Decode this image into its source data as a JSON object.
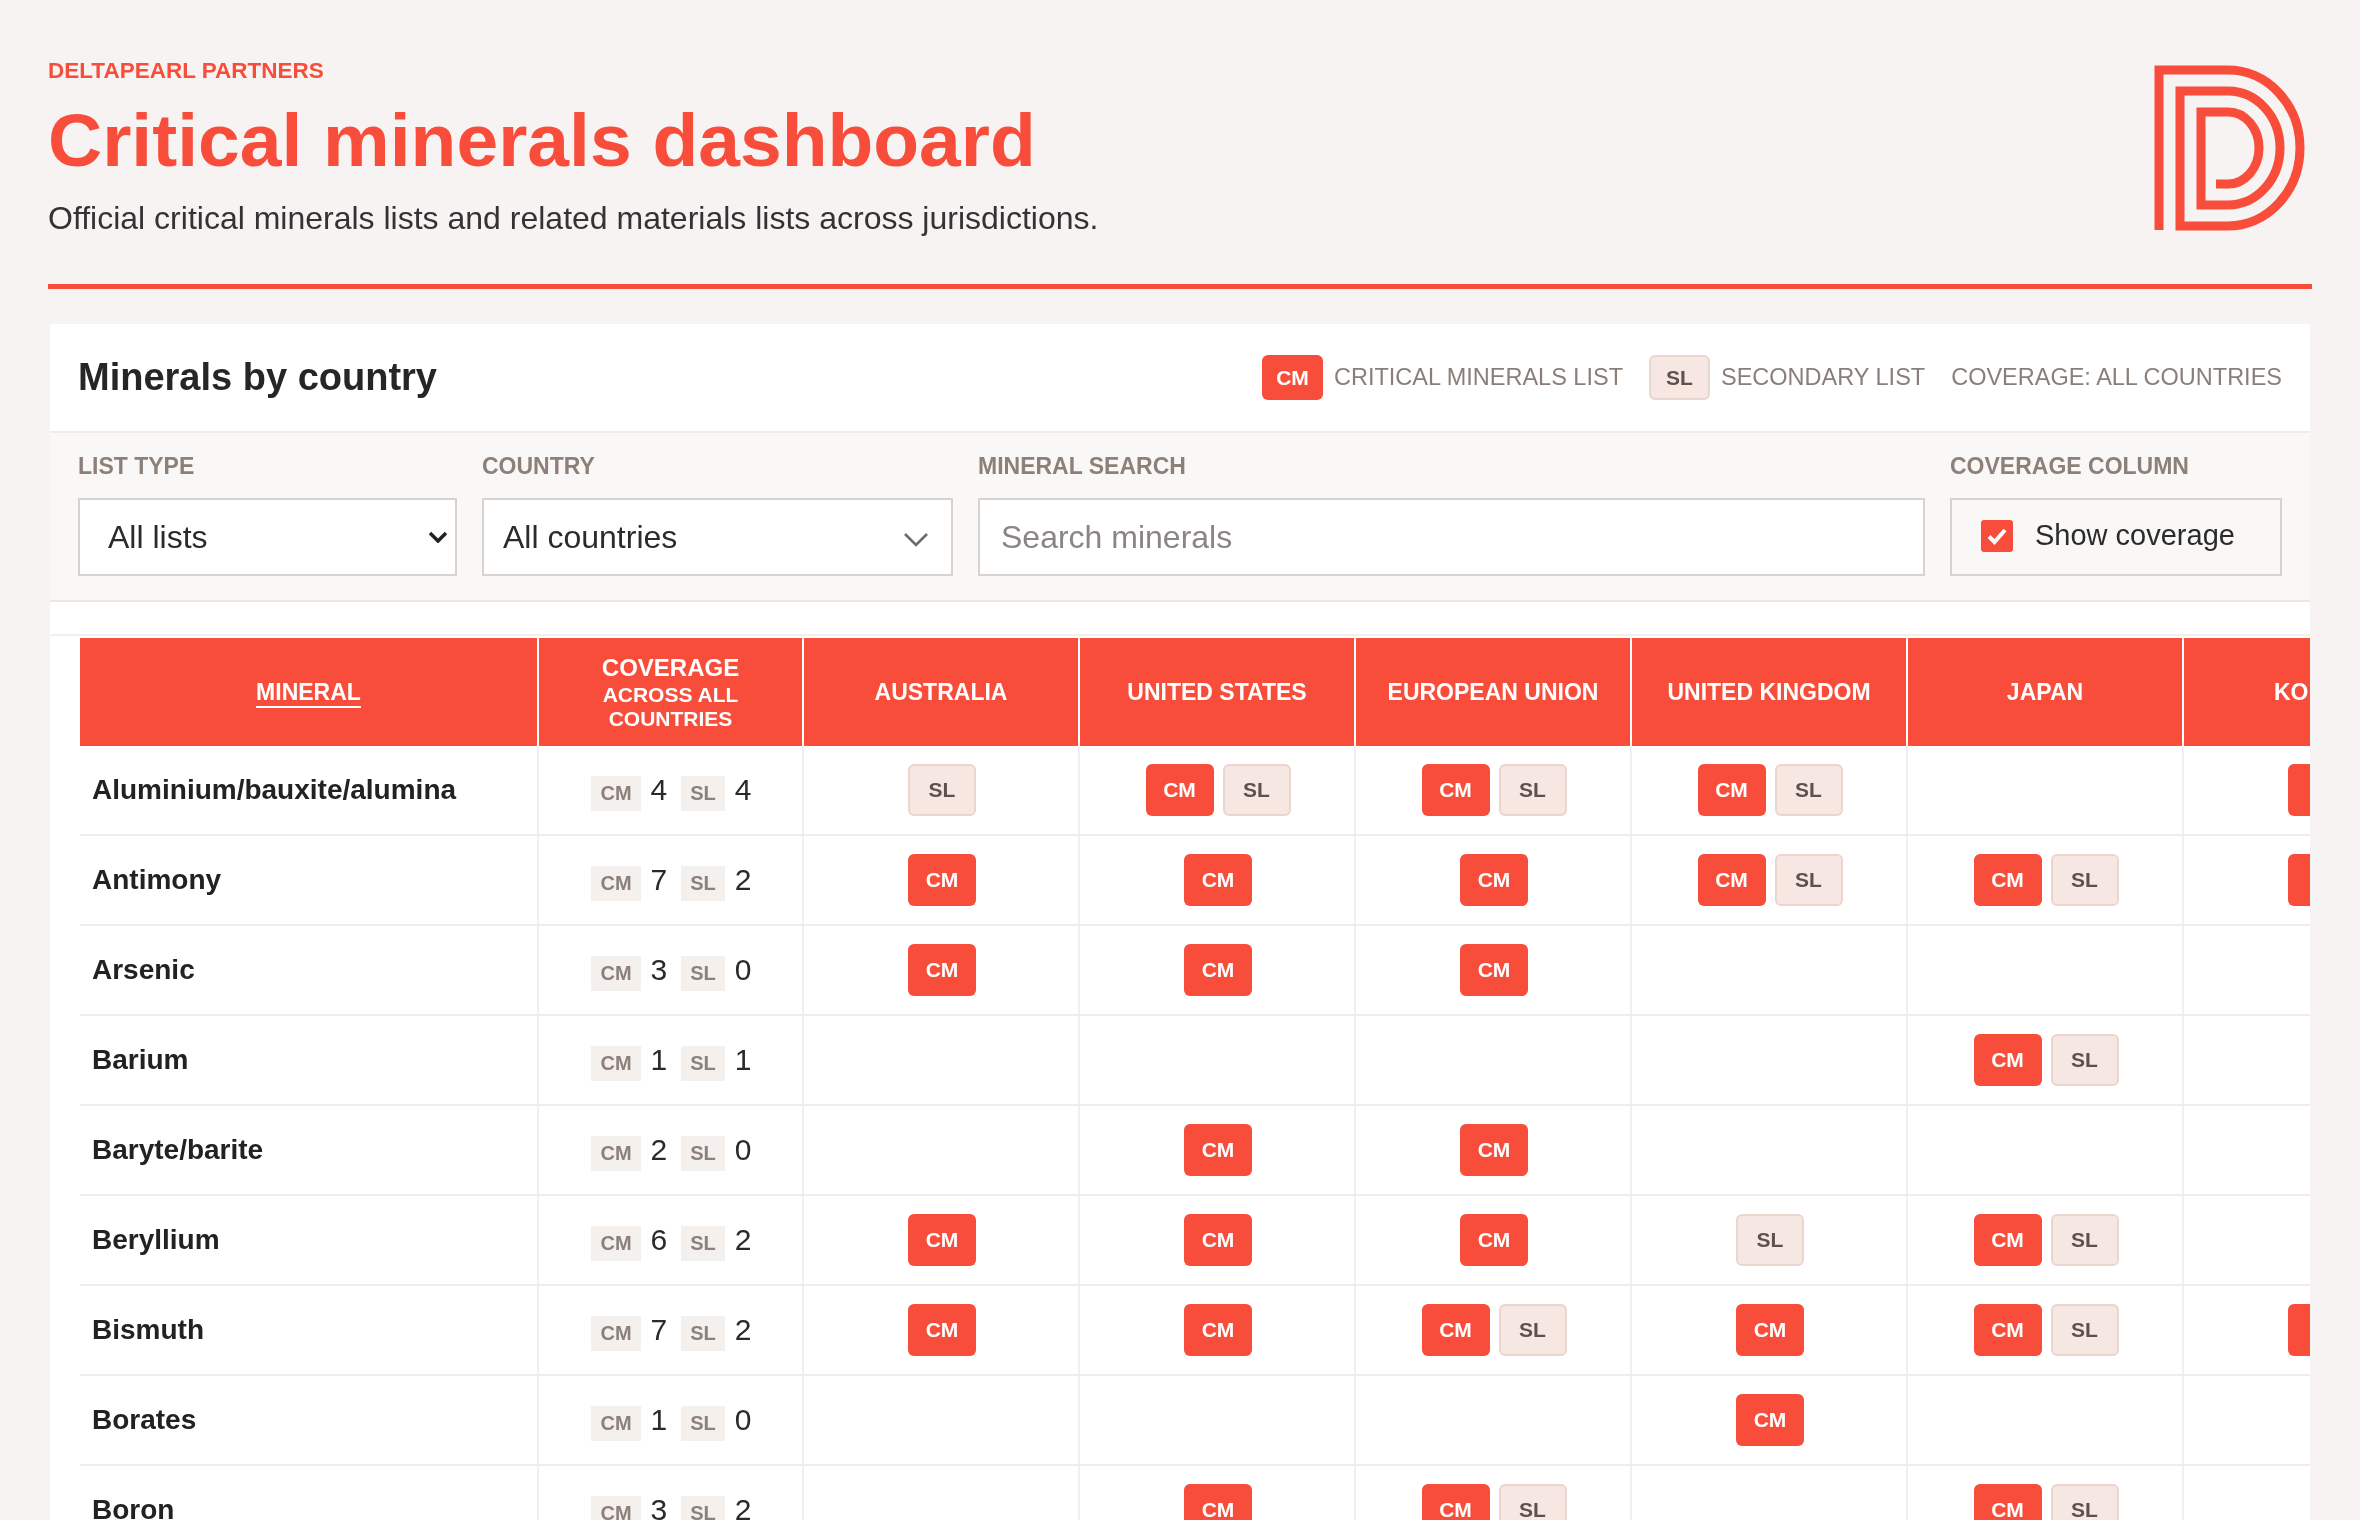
{
  "header": {
    "eyebrow": "DELTAPEARL PARTNERS",
    "title": "Critical minerals dashboard",
    "subtitle": "Official critical minerals lists and related materials lists across jurisdictions."
  },
  "panel": {
    "title": "Minerals by country",
    "legend": [
      {
        "kind": "cm",
        "badge": "CM",
        "label": "CRITICAL MINERALS LIST"
      },
      {
        "kind": "sl",
        "badge": "SL",
        "label": "SECONDARY LIST"
      }
    ],
    "coverage_note": "COVERAGE: ALL COUNTRIES"
  },
  "filters": [
    {
      "kind": "select",
      "label": "LIST TYPE",
      "value": "All lists"
    },
    {
      "kind": "dropdown",
      "label": "COUNTRY",
      "value": "All countries"
    },
    {
      "kind": "search",
      "label": "MINERAL SEARCH",
      "placeholder": "Search minerals"
    },
    {
      "kind": "checkbox",
      "label": "COVERAGE COLUMN",
      "text": "Show coverage",
      "checked": true
    }
  ],
  "table": {
    "columns": [
      {
        "kind": "mineral",
        "label": "MINERAL",
        "sorted": true
      },
      {
        "kind": "coverage",
        "label": "COVERAGE",
        "sublabel": "ACROSS ALL COUNTRIES",
        "sorted": false
      },
      {
        "kind": "country",
        "label": "AUSTRALIA",
        "sorted": false
      },
      {
        "kind": "country",
        "label": "UNITED STATES",
        "sorted": false
      },
      {
        "kind": "country",
        "label": "EUROPEAN UNION",
        "sorted": false
      },
      {
        "kind": "country",
        "label": "UNITED KINGDOM",
        "sorted": false
      },
      {
        "kind": "country",
        "label": "JAPAN",
        "sorted": false
      },
      {
        "kind": "cut",
        "label": "KO",
        "sorted": false
      }
    ],
    "rows": [
      {
        "cells": [
          "Aluminium/bauxite/alumina",
          [
            {
              "tag": "CM",
              "count": "4"
            },
            {
              "tag": "SL",
              "count": "4"
            }
          ],
          [
            {
              "kind": "sl",
              "label": "SL"
            }
          ],
          [
            {
              "kind": "cm",
              "label": "CM"
            },
            {
              "kind": "sl",
              "label": "SL"
            }
          ],
          [
            {
              "kind": "cm",
              "label": "CM"
            },
            {
              "kind": "sl",
              "label": "SL"
            }
          ],
          [
            {
              "kind": "cm",
              "label": "CM"
            },
            {
              "kind": "sl",
              "label": "SL"
            }
          ],
          "",
          [
            {
              "kind": "cm"
            }
          ]
        ]
      },
      {
        "cells": [
          "Antimony",
          [
            {
              "tag": "CM",
              "count": "7"
            },
            {
              "tag": "SL",
              "count": "2"
            }
          ],
          [
            {
              "kind": "cm",
              "label": "CM"
            }
          ],
          [
            {
              "kind": "cm",
              "label": "CM"
            }
          ],
          [
            {
              "kind": "cm",
              "label": "CM"
            }
          ],
          [
            {
              "kind": "cm",
              "label": "CM"
            },
            {
              "kind": "sl",
              "label": "SL"
            }
          ],
          [
            {
              "kind": "cm",
              "label": "CM"
            },
            {
              "kind": "sl",
              "label": "SL"
            }
          ],
          [
            {
              "kind": "cm"
            }
          ]
        ]
      },
      {
        "cells": [
          "Arsenic",
          [
            {
              "tag": "CM",
              "count": "3"
            },
            {
              "tag": "SL",
              "count": "0"
            }
          ],
          [
            {
              "kind": "cm",
              "label": "CM"
            }
          ],
          [
            {
              "kind": "cm",
              "label": "CM"
            }
          ],
          [
            {
              "kind": "cm",
              "label": "CM"
            }
          ],
          "",
          "",
          ""
        ]
      },
      {
        "cells": [
          "Barium",
          [
            {
              "tag": "CM",
              "count": "1"
            },
            {
              "tag": "SL",
              "count": "1"
            }
          ],
          "",
          "",
          "",
          "",
          [
            {
              "kind": "cm",
              "label": "CM"
            },
            {
              "kind": "sl",
              "label": "SL"
            }
          ],
          ""
        ]
      },
      {
        "cells": [
          "Baryte/barite",
          [
            {
              "tag": "CM",
              "count": "2"
            },
            {
              "tag": "SL",
              "count": "0"
            }
          ],
          "",
          [
            {
              "kind": "cm",
              "label": "CM"
            }
          ],
          [
            {
              "kind": "cm",
              "label": "CM"
            }
          ],
          "",
          "",
          ""
        ]
      },
      {
        "cells": [
          "Beryllium",
          [
            {
              "tag": "CM",
              "count": "6"
            },
            {
              "tag": "SL",
              "count": "2"
            }
          ],
          [
            {
              "kind": "cm",
              "label": "CM"
            }
          ],
          [
            {
              "kind": "cm",
              "label": "CM"
            }
          ],
          [
            {
              "kind": "cm",
              "label": "CM"
            }
          ],
          [
            {
              "kind": "sl",
              "label": "SL"
            }
          ],
          [
            {
              "kind": "cm",
              "label": "CM"
            },
            {
              "kind": "sl",
              "label": "SL"
            }
          ],
          ""
        ]
      },
      {
        "cells": [
          "Bismuth",
          [
            {
              "tag": "CM",
              "count": "7"
            },
            {
              "tag": "SL",
              "count": "2"
            }
          ],
          [
            {
              "kind": "cm",
              "label": "CM"
            }
          ],
          [
            {
              "kind": "cm",
              "label": "CM"
            }
          ],
          [
            {
              "kind": "cm",
              "label": "CM"
            },
            {
              "kind": "sl",
              "label": "SL"
            }
          ],
          [
            {
              "kind": "cm",
              "label": "CM"
            }
          ],
          [
            {
              "kind": "cm",
              "label": "CM"
            },
            {
              "kind": "sl",
              "label": "SL"
            }
          ],
          [
            {
              "kind": "cm"
            }
          ]
        ]
      },
      {
        "cells": [
          "Borates",
          [
            {
              "tag": "CM",
              "count": "1"
            },
            {
              "tag": "SL",
              "count": "0"
            }
          ],
          "",
          "",
          "",
          [
            {
              "kind": "cm",
              "label": "CM"
            }
          ],
          "",
          ""
        ]
      },
      {
        "cells": [
          "Boron",
          [
            {
              "tag": "CM",
              "count": "3"
            },
            {
              "tag": "SL",
              "count": "2"
            }
          ],
          "",
          [
            {
              "kind": "cm",
              "label": "CM"
            }
          ],
          [
            {
              "kind": "cm",
              "label": "CM"
            },
            {
              "kind": "sl",
              "label": "SL"
            }
          ],
          "",
          [
            {
              "kind": "cm",
              "label": "CM"
            },
            {
              "kind": "sl",
              "label": "SL"
            }
          ],
          ""
        ]
      }
    ]
  }
}
